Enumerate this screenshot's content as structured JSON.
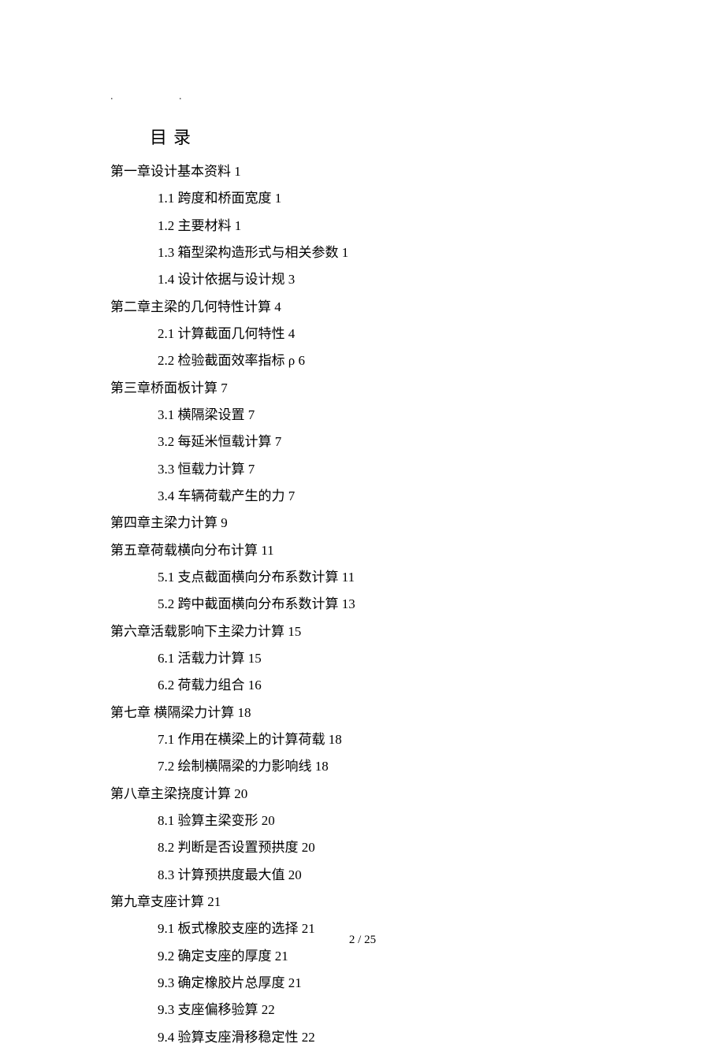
{
  "dots": ".  .",
  "title": "目录",
  "toc": [
    {
      "level": 1,
      "text": "第一章设计基本资料 1"
    },
    {
      "level": 2,
      "text": "1.1 跨度和桥面宽度 1"
    },
    {
      "level": 2,
      "text": "1.2 主要材料 1"
    },
    {
      "level": 2,
      "text": "1.3 箱型梁构造形式与相关参数 1"
    },
    {
      "level": 2,
      "text": "1.4 设计依据与设计规 3"
    },
    {
      "level": 1,
      "text": "第二章主梁的几何特性计算 4"
    },
    {
      "level": 2,
      "text": "2.1 计算截面几何特性 4"
    },
    {
      "level": 2,
      "text": "2.2 检验截面效率指标 ρ 6"
    },
    {
      "level": 1,
      "text": "第三章桥面板计算 7"
    },
    {
      "level": 2,
      "text": "3.1 横隔梁设置 7"
    },
    {
      "level": 2,
      "text": "3.2  每延米恒载计算 7"
    },
    {
      "level": 2,
      "text": "3.3 恒载力计算 7"
    },
    {
      "level": 2,
      "text": "3.4 车辆荷载产生的力 7"
    },
    {
      "level": 1,
      "text": "第四章主梁力计算 9"
    },
    {
      "level": 1,
      "text": "第五章荷载横向分布计算 11"
    },
    {
      "level": 2,
      "text": "5.1  支点截面横向分布系数计算 11"
    },
    {
      "level": 2,
      "text": "5.2 跨中截面横向分布系数计算 13"
    },
    {
      "level": 1,
      "text": "第六章活载影响下主梁力计算 15"
    },
    {
      "level": 2,
      "text": "6.1 活载力计算 15"
    },
    {
      "level": 2,
      "text": "6.2 荷载力组合 16"
    },
    {
      "level": 1,
      "text": "第七章  横隔梁力计算 18"
    },
    {
      "level": 2,
      "text": "7.1 作用在横梁上的计算荷载 18"
    },
    {
      "level": 2,
      "text": "7.2 绘制横隔梁的力影响线 18"
    },
    {
      "level": 1,
      "text": "第八章主梁挠度计算 20"
    },
    {
      "level": 2,
      "text": "8.1 验算主梁变形 20"
    },
    {
      "level": 2,
      "text": "8.2 判断是否设置预拱度 20"
    },
    {
      "level": 2,
      "text": "8.3  计算预拱度最大值 20"
    },
    {
      "level": 1,
      "text": "第九章支座计算 21"
    },
    {
      "level": 2,
      "text": "9.1 板式橡胶支座的选择 21"
    },
    {
      "level": 2,
      "text": "9.2 确定支座的厚度 21"
    },
    {
      "level": 2,
      "text": "9.3 确定橡胶片总厚度 21"
    },
    {
      "level": 2,
      "text": "9.3 支座偏移验算 22"
    },
    {
      "level": 2,
      "text": "9.4 验算支座滑移稳定性 22"
    }
  ],
  "page_number": "2  / 25"
}
